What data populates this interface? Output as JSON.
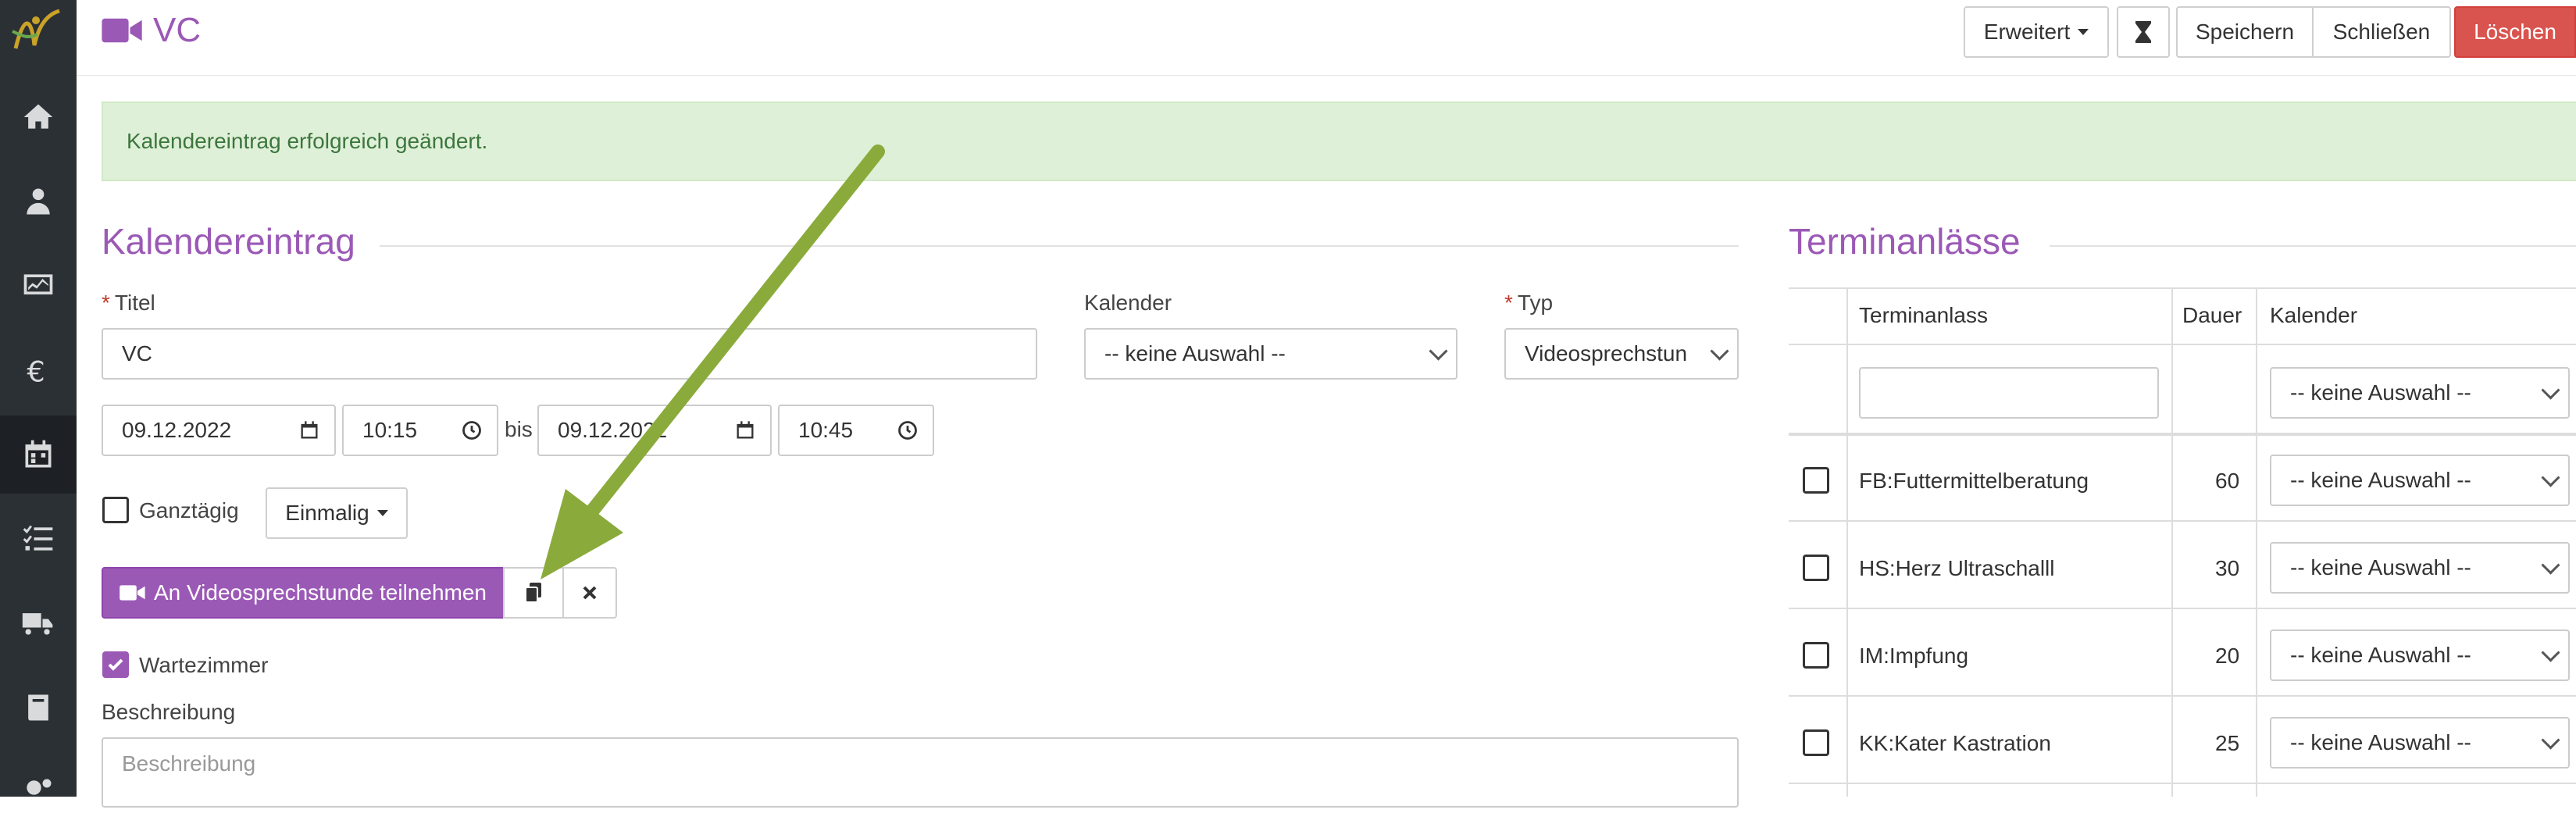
{
  "header": {
    "title": "VC",
    "buttons": {
      "advanced": "Erweitert",
      "save": "Speichern",
      "close": "Schließen",
      "delete": "Löschen"
    }
  },
  "alert": {
    "message": "Kalendereintrag erfolgreich geändert."
  },
  "entry": {
    "section_title": "Kalendereintrag",
    "title_label": "Titel",
    "title_value": "VC",
    "calendar_label": "Kalender",
    "calendar_value": "-- keine Auswahl --",
    "type_label": "Typ",
    "type_value": "Videosprechstun",
    "start_date": "09.12.2022",
    "start_time": "10:15",
    "until_label": "bis",
    "end_date": "09.12.2022",
    "end_time": "10:45",
    "allday_label": "Ganztägig",
    "recurrence_value": "Einmalig",
    "join_button": "An Videosprechstunde teilnehmen",
    "waiting_room_label": "Wartezimmer",
    "waiting_room_checked": true,
    "description_label": "Beschreibung",
    "description_placeholder": "Beschreibung"
  },
  "occasions": {
    "section_title": "Terminanlässe",
    "columns": {
      "name": "Terminanlass",
      "duration": "Dauer",
      "calendar": "Kalender"
    },
    "filter_calendar": "-- keine Auswahl --",
    "rows": [
      {
        "name": "FB:Futtermittelberatung",
        "duration": "60",
        "calendar": "-- keine Auswahl --"
      },
      {
        "name": "HS:Herz Ultraschalll",
        "duration": "30",
        "calendar": "-- keine Auswahl --"
      },
      {
        "name": "IM:Impfung",
        "duration": "20",
        "calendar": "-- keine Auswahl --"
      },
      {
        "name": "KK:Kater Kastration",
        "duration": "25",
        "calendar": "-- keine Auswahl --"
      }
    ]
  },
  "colors": {
    "accent": "#9b59b6",
    "danger": "#d9534f",
    "success_bg": "#dff0d8",
    "annotation_arrow": "#8aab3c",
    "sidebar": "#2b3035"
  },
  "icons": [
    "logo-icon",
    "home-icon",
    "doctor-icon",
    "monitor-chart-icon",
    "euro-icon",
    "calendar-icon",
    "checklist-icon",
    "truck-icon",
    "book-icon",
    "gears-icon",
    "video-camera-icon",
    "hourglass-icon",
    "copy-icon",
    "close-icon",
    "calendar-picker-icon",
    "clock-icon"
  ]
}
